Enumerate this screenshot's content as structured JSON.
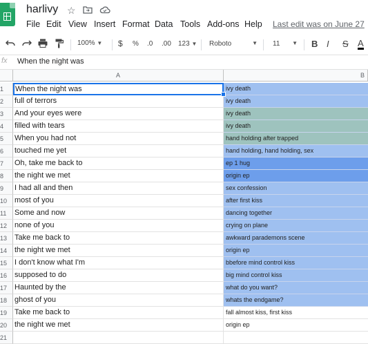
{
  "app": {
    "title": "harlivy",
    "icons": [
      "star-icon",
      "move-to-folder-icon",
      "cloud-status-icon"
    ],
    "last_edit": "Last edit was on June 27"
  },
  "menu": [
    "File",
    "Edit",
    "View",
    "Insert",
    "Format",
    "Data",
    "Tools",
    "Add-ons",
    "Help"
  ],
  "toolbar": {
    "zoom": "100%",
    "currency": "$",
    "percent": "%",
    "decrease_decimal": ".0",
    "increase_decimal": ".00",
    "more_formats": "123",
    "font": "Roboto",
    "font_size": "11",
    "bold": "B",
    "italic": "I",
    "strikethrough": "S",
    "text_color": "A",
    "text_color_hex": "#000000"
  },
  "formula_bar": {
    "fx": "fx",
    "value": "When the night was"
  },
  "columns": [
    "A",
    "B"
  ],
  "rows": [
    {
      "num": "1",
      "a": "When the night was",
      "b": "ivy death",
      "color": "#9fc0f0"
    },
    {
      "num": "2",
      "a": "full of terrors",
      "b": "ivy death",
      "color": "#9fc0f0"
    },
    {
      "num": "3",
      "a": "And your eyes were",
      "b": "ivy death",
      "color": "#9ec3be"
    },
    {
      "num": "4",
      "a": "filled with tears",
      "b": "ivy death",
      "color": "#9ec3be"
    },
    {
      "num": "5",
      "a": "When you had not",
      "b": "hand holding after trapped",
      "color": "#9ec3be"
    },
    {
      "num": "6",
      "a": "touched me yet",
      "b": "hand holding, hand holding, sex",
      "color": "#9fc0f0"
    },
    {
      "num": "7",
      "a": "Oh, take me back to",
      "b": "ep 1 hug",
      "color": "#6d9eeb"
    },
    {
      "num": "8",
      "a": "the night we met",
      "b": "origin ep",
      "color": "#6d9eeb"
    },
    {
      "num": "9",
      "a": "I had all and then",
      "b": "sex confession",
      "color": "#9fc0f0"
    },
    {
      "num": "10",
      "a": "most of you",
      "b": "after first kiss",
      "color": "#9fc0f0"
    },
    {
      "num": "11",
      "a": "Some and now",
      "b": "dancing together",
      "color": "#9fc0f0"
    },
    {
      "num": "12",
      "a": "none of you",
      "b": "crying on plane",
      "color": "#9fc0f0"
    },
    {
      "num": "13",
      "a": "Take me back to",
      "b": "awkward parademons scene",
      "color": "#9fc0f0"
    },
    {
      "num": "14",
      "a": "the night we met",
      "b": "origin ep",
      "color": "#9fc0f0"
    },
    {
      "num": "15",
      "a": "I don't know what I'm",
      "b": "bbefore mind control kiss",
      "color": "#9fc0f0"
    },
    {
      "num": "16",
      "a": "supposed to do",
      "b": "big mind control kiss",
      "color": "#9fc0f0"
    },
    {
      "num": "17",
      "a": "Haunted by the",
      "b": "what do you want?",
      "color": "#9fc0f0"
    },
    {
      "num": "18",
      "a": "ghost of you",
      "b": "whats the endgame?",
      "color": "#9fc0f0"
    },
    {
      "num": "19",
      "a": "Take me back to",
      "b": "fall almost kiss, first kiss",
      "color": "#ffffff"
    },
    {
      "num": "20",
      "a": "the night we met",
      "b": "origin ep",
      "color": "#ffffff"
    },
    {
      "num": "21",
      "a": "",
      "b": "",
      "color": "#ffffff"
    }
  ]
}
